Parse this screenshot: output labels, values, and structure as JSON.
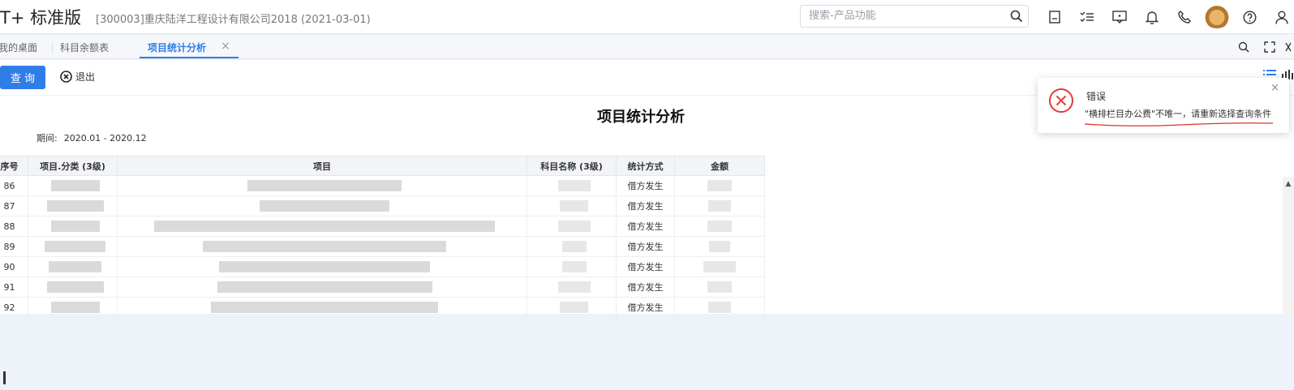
{
  "header": {
    "brand": "T+ 标准版",
    "company": "[300003]重庆陆洋工程设计有限公司2018   (2021-03-01)",
    "search_placeholder": "搜索-产品功能",
    "icons": [
      "search-icon",
      "save-icon",
      "tasks-icon",
      "message-icon",
      "bell-icon",
      "phone-icon",
      "avatar",
      "help-icon",
      "user-icon"
    ]
  },
  "tabs": {
    "items": [
      {
        "label": "我的桌面"
      },
      {
        "label": "科目余额表"
      },
      {
        "label": "项目统计分析"
      }
    ],
    "close_glyph": "×"
  },
  "toolbar": {
    "query_label": "查 询",
    "exit_label": "退出"
  },
  "report": {
    "title": "项目统计分析",
    "period_label": "期间:",
    "period_value": "2020.01 - 2020.12"
  },
  "table": {
    "headers": [
      "序号",
      "项目.分类 (3级)",
      "项目",
      "科目名称 (3级)",
      "统计方式",
      "金额"
    ],
    "rows": [
      {
        "no": "86",
        "method": "借方发生"
      },
      {
        "no": "87",
        "method": "借方发生"
      },
      {
        "no": "88",
        "method": "借方发生"
      },
      {
        "no": "89",
        "method": "借方发生"
      },
      {
        "no": "90",
        "method": "借方发生"
      },
      {
        "no": "91",
        "method": "借方发生"
      },
      {
        "no": "92",
        "method": "借方发生"
      }
    ]
  },
  "toast": {
    "title": "错误",
    "message": "\"横排栏目办公费\"不唯一，请重新选择查询条件",
    "close_glyph": "×"
  },
  "colors": {
    "accent": "#2f7ee8",
    "error": "#e23b3b",
    "annotation": "#d9342b"
  }
}
